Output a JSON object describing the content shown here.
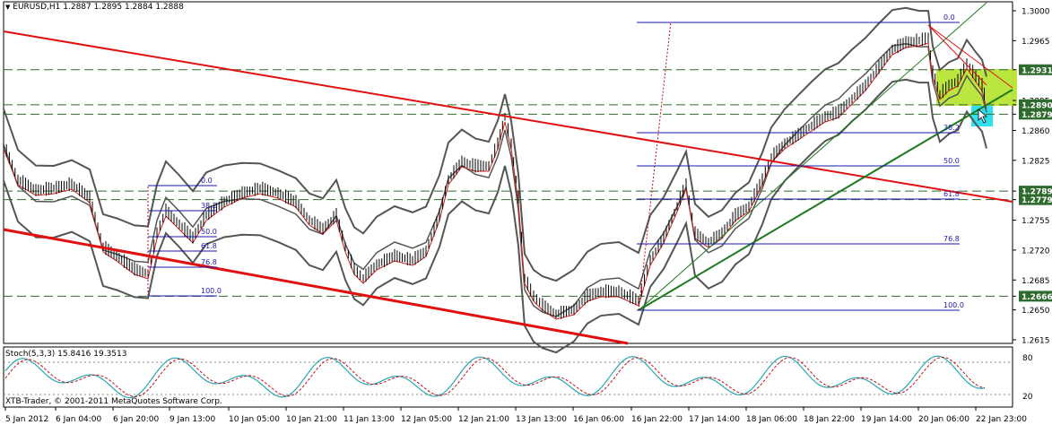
{
  "main_chart": {
    "symbol_header": "EURUSD,H1",
    "ohlc": "1.2887 1.2895 1.2884 1.2888",
    "price_axis": [
      "1.3000",
      "1.2965",
      "1.2931",
      "1.2895",
      "1.2890",
      "1.2879",
      "1.2860",
      "1.2825",
      "1.2789",
      "1.2779",
      "1.2755",
      "1.2720",
      "1.2685",
      "1.2666",
      "1.2650",
      "1.2615"
    ],
    "highlighted_levels": [
      {
        "price": "1.2931",
        "color": "#2f6b2f"
      },
      {
        "price": "1.2890",
        "color": "#2f6b2f"
      },
      {
        "price": "1.2879",
        "color": "#2f6b2f"
      },
      {
        "price": "1.2789",
        "color": "#2f6b2f"
      },
      {
        "price": "1.2779",
        "color": "#2f6b2f"
      },
      {
        "price": "1.2666",
        "color": "#2f6b2f"
      }
    ],
    "fib_left": [
      "0.0",
      "38.2",
      "50.0",
      "61.8",
      "76.8",
      "100.0"
    ],
    "fib_right": [
      "0.0",
      "38.2",
      "50.0",
      "61.8",
      "76.8",
      "100.0"
    ]
  },
  "stoch": {
    "header": "Stoch(5,3,3) 15.8416 19.3513",
    "levels": [
      "80",
      "20"
    ]
  },
  "copyright": "XTB-Trader, © 2001-2011 MetaQuotes Software Corp.",
  "time_axis": [
    "5 Jan 2012",
    "6 Jan 04:00",
    "6 Jan 20:00",
    "9 Jan 13:00",
    "10 Jan 05:00",
    "10 Jan 21:00",
    "11 Jan 13:00",
    "12 Jan 05:00",
    "12 Jan 21:00",
    "13 Jan 13:00",
    "16 Jan 06:00",
    "16 Jan 22:00",
    "17 Jan 14:00",
    "18 Jan 06:00",
    "18 Jan 22:00",
    "19 Jan 14:00",
    "20 Jan 06:00",
    "22 Jan 23:00"
  ],
  "colors": {
    "channel_red": "#e01010",
    "trend_green": "#1f7a1f",
    "bands": "#555555",
    "fib_blue": "#1a1aa8",
    "zone_green": "#b7e536",
    "zone_cyan": "#2fe0f0",
    "stoch_main": "#2aa7b5",
    "stoch_signal": "#c01010"
  }
}
